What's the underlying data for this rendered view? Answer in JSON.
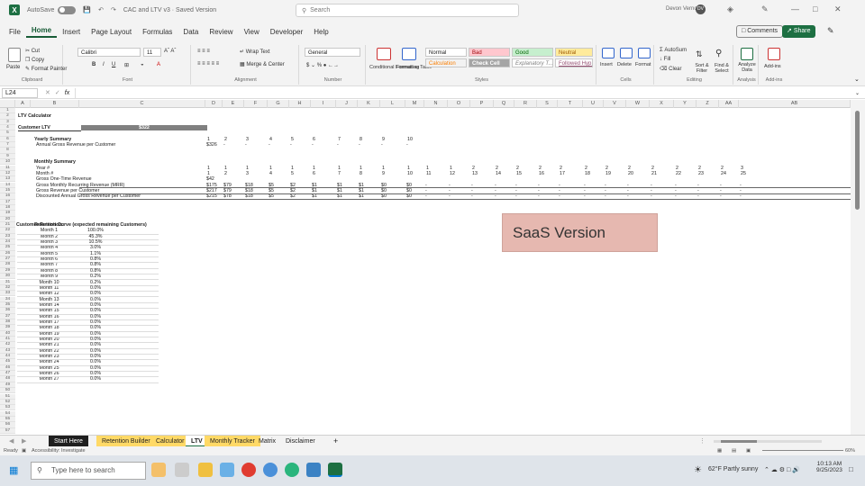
{
  "titlebar": {
    "autosave": "AutoSave",
    "autosave_state": "Off",
    "filename": "CAC and LTV v3 · Saved Version",
    "search_placeholder": "Search",
    "user": "Devon Vernon",
    "user_initials": "DV"
  },
  "menu": {
    "items": [
      "File",
      "Home",
      "Insert",
      "Page Layout",
      "Formulas",
      "Data",
      "Review",
      "View",
      "Developer",
      "Help"
    ],
    "comments": "Comments",
    "share": "Share"
  },
  "ribbon": {
    "paste": "Paste",
    "cut": "Cut",
    "copy": "Copy",
    "format_painter": "Format Painter",
    "clipboard": "Clipboard",
    "font_name": "Calibri",
    "font_size": "11",
    "font": "Font",
    "wrap_text": "Wrap Text",
    "merge_center": "Merge & Center",
    "alignment": "Alignment",
    "number_format": "General",
    "number": "Number",
    "conditional": "Conditional Formatting",
    "format_table": "Format as Table",
    "styles_row1": [
      "Normal",
      "Bad",
      "Good",
      "Neutral"
    ],
    "styles_row2": [
      "Calculation",
      "Check Cell",
      "Explanatory T...",
      "Followed Hyp..."
    ],
    "styles": "Styles",
    "insert": "Insert",
    "delete": "Delete",
    "format": "Format",
    "cells": "Cells",
    "autosum": "AutoSum",
    "fill": "Fill",
    "clear": "Clear",
    "sort_filter": "Sort & Filter",
    "find_select": "Find & Select",
    "editing": "Editing",
    "analyze_data": "Analyze Data",
    "analysis": "Analysis",
    "addins": "Add-ins"
  },
  "formula_bar": {
    "name_box": "L24",
    "fx": "fx",
    "content": ""
  },
  "columns": [
    "A",
    "B",
    "C",
    "D",
    "E",
    "F",
    "G",
    "H",
    "I",
    "J",
    "K",
    "L",
    "M",
    "N",
    "O",
    "P",
    "Q",
    "R",
    "S",
    "T",
    "U",
    "V",
    "W",
    "X",
    "Y",
    "Z",
    "AA",
    "AB"
  ],
  "sheet": {
    "title": "LTV Calculator",
    "customer_ltv_label": "Customer LTV",
    "customer_ltv_value": "$322",
    "yearly_summary": "Yearly Summary",
    "annual_gross_label": "Annual Gross Revenue per Customer",
    "years": [
      "1",
      "2",
      "3",
      "4",
      "5",
      "6",
      "7",
      "8",
      "9",
      "10"
    ],
    "annual_gross_values": [
      "$326",
      "-",
      "-",
      "-",
      "-",
      "-",
      "-",
      "-",
      "-",
      "-"
    ],
    "monthly_summary": "Monthly Summary",
    "year_label": "Year #",
    "month_label": "Month #",
    "one_time_label": "Gross One-Time Revenue",
    "mrr_label": "Gross Monthly Recurring Revenue (MRR)",
    "gross_rev_label": "Gross Revenue per Customer",
    "discounted_label": "Discounted Annual Gross Revenue per Customer",
    "year_values": [
      "1",
      "1",
      "1",
      "1",
      "1",
      "1",
      "1",
      "1",
      "1",
      "1",
      "1",
      "1",
      "2",
      "2",
      "2",
      "2",
      "2",
      "2",
      "2",
      "2",
      "2",
      "2",
      "2",
      "2",
      "3",
      "3"
    ],
    "month_values": [
      "1",
      "2",
      "3",
      "4",
      "5",
      "6",
      "7",
      "8",
      "9",
      "10",
      "11",
      "12",
      "13",
      "14",
      "15",
      "16",
      "17",
      "18",
      "19",
      "20",
      "21",
      "22",
      "23",
      "24",
      "25",
      "26"
    ],
    "one_time_values": [
      "$42"
    ],
    "mrr_values": [
      "$175",
      "$79",
      "$18",
      "$5",
      "$2",
      "$1",
      "$1",
      "$1",
      "$0",
      "$0",
      "-",
      "-",
      "-",
      "-",
      "-",
      "-",
      "-",
      "-",
      "-",
      "-",
      "-",
      "-",
      "-",
      "-",
      "-",
      "-"
    ],
    "gross_rev_values": [
      "$217",
      "$79",
      "$18",
      "$5",
      "$2",
      "$1",
      "$1",
      "$1",
      "$0",
      "$0",
      "-",
      "-",
      "-",
      "-",
      "-",
      "-",
      "-",
      "-",
      "-",
      "-",
      "-",
      "-",
      "-",
      "-",
      "-",
      "-"
    ],
    "discounted_values": [
      "$215",
      "$78",
      "$18",
      "$5",
      "$2",
      "$1",
      "$1",
      "$1",
      "$0",
      "$0",
      "-",
      "-",
      "-",
      "-",
      "-",
      "-",
      "-",
      "-",
      "-",
      "-",
      "-",
      "-",
      "-",
      "-",
      "-",
      "-"
    ],
    "retention_label": "Customer Retention:",
    "retention_curve_label": "Retention Curve (expected remaining Customers)",
    "retention_months": [
      "Month 1",
      "Month 2",
      "Month 3",
      "Month 4",
      "Month 5",
      "Month 6",
      "Month 7",
      "Month 8",
      "Month 9",
      "Month 10",
      "Month 11",
      "Month 12",
      "Month 13",
      "Month 14",
      "Month 15",
      "Month 16",
      "Month 17",
      "Month 18",
      "Month 19",
      "Month 20",
      "Month 21",
      "Month 22",
      "Month 23",
      "Month 24",
      "Month 25",
      "Month 26",
      "Month 27"
    ],
    "retention_values": [
      "100.0%",
      "45.3%",
      "10.5%",
      "3.0%",
      "1.1%",
      "0.8%",
      "0.8%",
      "0.8%",
      "0.2%",
      "0.2%",
      "0.0%",
      "0.0%",
      "0.0%",
      "0.0%",
      "0.0%",
      "0.0%",
      "0.0%",
      "0.0%",
      "0.0%",
      "0.0%",
      "0.0%",
      "0.0%",
      "0.0%",
      "0.0%",
      "0.0%",
      "0.0%",
      "0.0%"
    ],
    "saas_label": "SaaS Version"
  },
  "sheet_tabs": [
    "Start Here",
    "Retention Builder",
    "Calculator",
    "LTV",
    "Monthly Tracker",
    "Matrix",
    "Disclaimer"
  ],
  "status": {
    "ready": "Ready",
    "accessibility": "Accessibility: Investigate",
    "zoom": "60%"
  },
  "taskbar": {
    "search_placeholder": "Type here to search",
    "weather": "62°F  Partly sunny",
    "time": "10:13 AM",
    "date": "9/25/2023"
  },
  "colors": {
    "excel_green": "#1d6f42",
    "saas_box": "#e6b8b0",
    "ltv_header": "#808080"
  }
}
